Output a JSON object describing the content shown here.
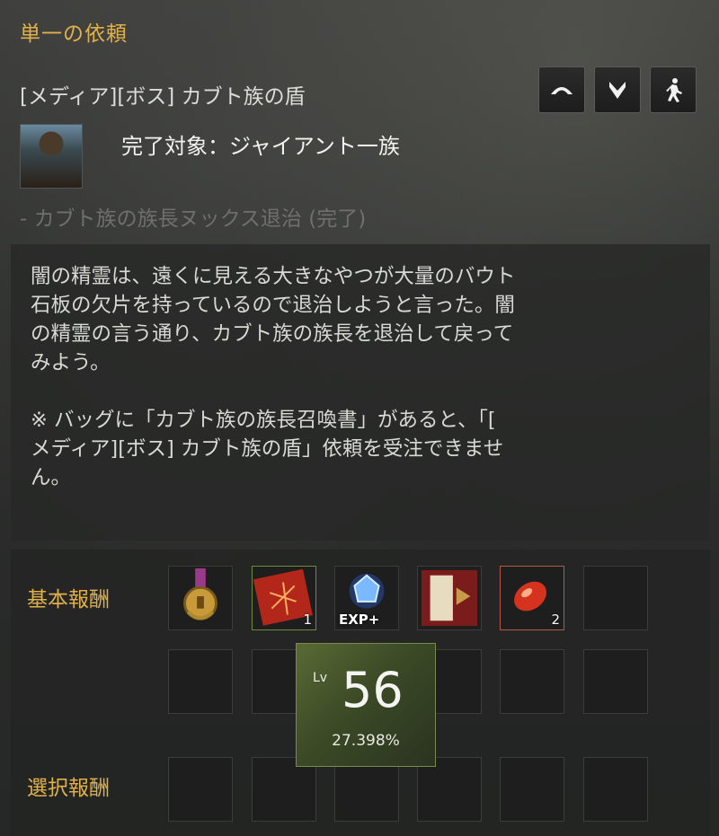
{
  "panel": {
    "title": "単一の依頼"
  },
  "quest": {
    "name": "[メディア][ボス] カブト族の盾",
    "target": "完了対象：ジャイアント一族",
    "sub_objective": "- カブト族の族長ヌックス退治 (完了)"
  },
  "controls": [
    {
      "icon": "chevron-up-icon"
    },
    {
      "icon": "chevron-down-icon"
    },
    {
      "icon": "auto-navigate-icon"
    }
  ],
  "description": {
    "paragraph1": "闇の精霊は、遠くに見える大きなやつが大量のバウト\n石板の欠片を持っているので退治しようと言った。闇\nの精霊の言う通り、カブト族の族長を退治して戻って\nみよう。",
    "paragraph2": "※ バッグに「カブト族の族長召喚書」があると、「[\nメディア][ボス] カブト族の盾」依頼を受注できませ\nん。"
  },
  "rewards": {
    "basic_label": "基本報酬",
    "select_label": "選択報酬",
    "basic_items": [
      {
        "icon": "medal-icon",
        "count": ""
      },
      {
        "icon": "red-book-icon",
        "count": "1"
      },
      {
        "icon": "exp-crystal-icon",
        "label": "EXP+",
        "count": ""
      },
      {
        "icon": "contribution-scroll-icon",
        "count": ""
      },
      {
        "icon": "red-gem-icon",
        "count": "2"
      }
    ]
  },
  "level_tooltip": {
    "lv_label": "Lv",
    "level": "56",
    "percent": "27.398%"
  }
}
